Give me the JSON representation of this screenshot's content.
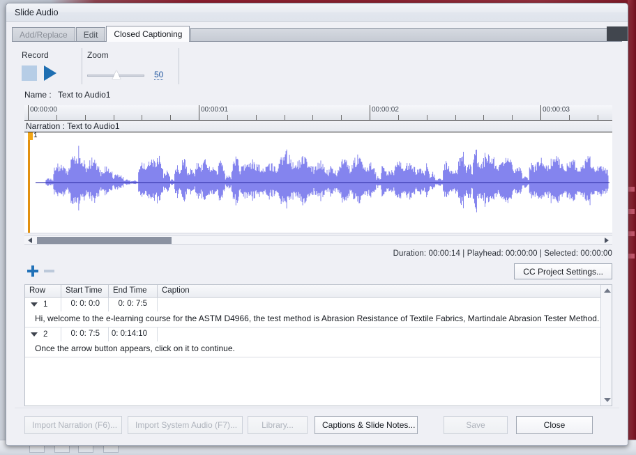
{
  "window": {
    "title": "Slide Audio"
  },
  "tabs": [
    {
      "label": "Add/Replace",
      "state": "disabled"
    },
    {
      "label": "Edit",
      "state": "enabled"
    },
    {
      "label": "Closed Captioning",
      "state": "active"
    }
  ],
  "toolbar": {
    "record_label": "Record",
    "stop_icon": "stop-square-icon",
    "play_icon": "play-triangle-icon",
    "zoom_label": "Zoom",
    "zoom_value": "50",
    "zoom_percent": 50
  },
  "clip": {
    "name_label": "Name :",
    "name_value": "Text to Audio1",
    "narration_label": "Narration : Text to Audio1",
    "clip_number": "1"
  },
  "ruler": {
    "ticks": [
      "00:00:00",
      "00:00:01",
      "00:00:02",
      "00:00:03"
    ],
    "minor_per_major": 5
  },
  "status": {
    "text": "Duration:  00:00:14  |  Playhead:  00:00:00  |  Selected:  00:00:00",
    "duration": "00:00:14",
    "playhead": "00:00:00",
    "selected": "00:00:00"
  },
  "row_actions": {
    "add_icon": "plus-icon",
    "remove_icon": "minus-icon",
    "cc_project_settings": "CC Project Settings..."
  },
  "cc_table": {
    "columns": [
      "Row",
      "Start Time",
      "End Time",
      "Caption"
    ],
    "rows": [
      {
        "row": "1",
        "start_time": "0: 0: 0:0",
        "end_time": "0: 0: 7:5",
        "caption": "Hi, welcome to the e-learning course for the ASTM D4966, the test method is Abrasion Resistance of Textile Fabrics, Martindale Abrasion Tester Method."
      },
      {
        "row": "2",
        "start_time": "0: 0: 7:5",
        "end_time": "0: 0:14:10",
        "caption": "Once the arrow button appears, click on it to continue."
      }
    ]
  },
  "footer": {
    "import_narration": "Import Narration (F6)...",
    "import_system_audio": "Import System Audio (F7)...",
    "library": "Library...",
    "captions_slide_notes": "Captions & Slide Notes...",
    "save": "Save",
    "close": "Close"
  },
  "colors": {
    "waveform": "#8484ee",
    "waveform_axis": "#3a3ab0",
    "playhead": "#e2900f",
    "accent_blue": "#2272b8",
    "panel_bg": "#eff0f5",
    "titlebar_red": "#8c1f2f"
  }
}
